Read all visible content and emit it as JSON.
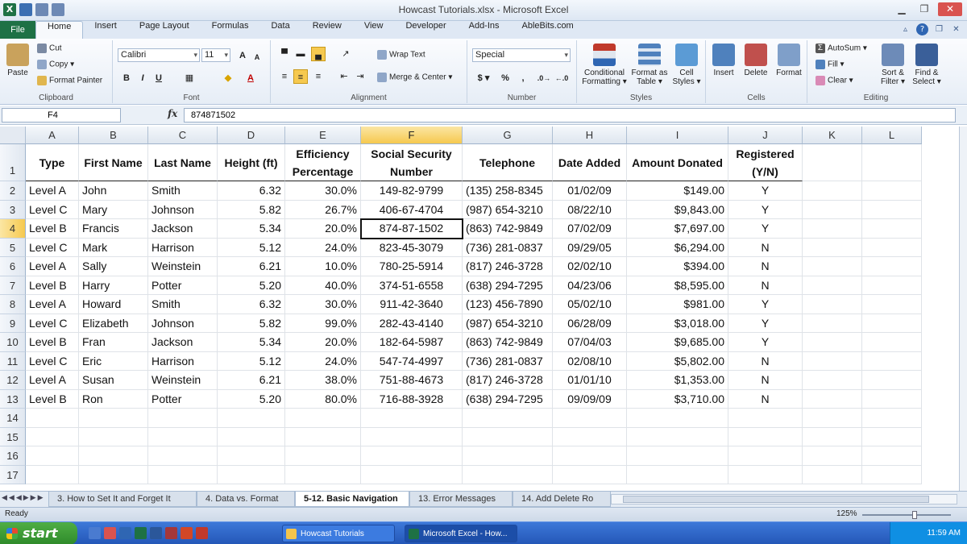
{
  "window": {
    "title": "Howcast Tutorials.xlsx - Microsoft Excel"
  },
  "tabs": [
    "File",
    "Home",
    "Insert",
    "Page Layout",
    "Formulas",
    "Data",
    "Review",
    "View",
    "Developer",
    "Add-Ins",
    "AbleBits.com"
  ],
  "ribbon": {
    "clipboard": {
      "paste": "Paste",
      "cut": "Cut",
      "copy": "Copy ▾",
      "format_painter": "Format Painter",
      "label": "Clipboard"
    },
    "font": {
      "name": "Calibri",
      "size": "11",
      "label": "Font"
    },
    "alignment": {
      "wrap": "Wrap Text",
      "merge": "Merge & Center ▾",
      "label": "Alignment"
    },
    "number": {
      "format": "Special",
      "label": "Number",
      "currency": "$ ▾",
      "percent": "%",
      "comma": ","
    },
    "styles": {
      "conditional": "Conditional Formatting ▾",
      "format_table": "Format as Table ▾",
      "cell_styles": "Cell Styles ▾",
      "label": "Styles"
    },
    "cells": {
      "insert": "Insert",
      "delete": "Delete",
      "format": "Format",
      "label": "Cells"
    },
    "editing": {
      "autosum": "AutoSum ▾",
      "fill": "Fill ▾",
      "clear": "Clear ▾",
      "sort": "Sort & Filter ▾",
      "find": "Find & Select ▾",
      "label": "Editing"
    }
  },
  "formula_bar": {
    "name_box": "F4",
    "fx": "fx",
    "value": "874871502"
  },
  "grid": {
    "columns": [
      "A",
      "B",
      "C",
      "D",
      "E",
      "F",
      "G",
      "H",
      "I",
      "J",
      "K",
      "L"
    ],
    "rows": [
      "1",
      "2",
      "3",
      "4",
      "5",
      "6",
      "7",
      "8",
      "9",
      "10",
      "11",
      "12",
      "13",
      "14",
      "15",
      "16",
      "17"
    ],
    "headers": [
      "Type",
      "First Name",
      "Last Name",
      "Height (ft)",
      "Efficiency Percentage",
      "Social Security Number",
      "Telephone",
      "Date Added",
      "Amount Donated",
      "Registered (Y/N)"
    ],
    "data": [
      [
        "Level A",
        "John",
        "Smith",
        "6.32",
        "30.0%",
        "149-82-9799",
        "(135) 258-8345",
        "01/02/09",
        "$149.00",
        "Y"
      ],
      [
        "Level C",
        "Mary",
        "Johnson",
        "5.82",
        "26.7%",
        "406-67-4704",
        "(987) 654-3210",
        "08/22/10",
        "$9,843.00",
        "Y"
      ],
      [
        "Level B",
        "Francis",
        "Jackson",
        "5.34",
        "20.0%",
        "874-87-1502",
        "(863) 742-9849",
        "07/02/09",
        "$7,697.00",
        "Y"
      ],
      [
        "Level C",
        "Mark",
        "Harrison",
        "5.12",
        "24.0%",
        "823-45-3079",
        "(736) 281-0837",
        "09/29/05",
        "$6,294.00",
        "N"
      ],
      [
        "Level A",
        "Sally",
        "Weinstein",
        "6.21",
        "10.0%",
        "780-25-5914",
        "(817) 246-3728",
        "02/02/10",
        "$394.00",
        "N"
      ],
      [
        "Level B",
        "Harry",
        "Potter",
        "5.20",
        "40.0%",
        "374-51-6558",
        "(638) 294-7295",
        "04/23/06",
        "$8,595.00",
        "N"
      ],
      [
        "Level A",
        "Howard",
        "Smith",
        "6.32",
        "30.0%",
        "911-42-3640",
        "(123) 456-7890",
        "05/02/10",
        "$981.00",
        "Y"
      ],
      [
        "Level C",
        "Elizabeth",
        "Johnson",
        "5.82",
        "99.0%",
        "282-43-4140",
        "(987) 654-3210",
        "06/28/09",
        "$3,018.00",
        "Y"
      ],
      [
        "Level B",
        "Fran",
        "Jackson",
        "5.34",
        "20.0%",
        "182-64-5987",
        "(863) 742-9849",
        "07/04/03",
        "$9,685.00",
        "Y"
      ],
      [
        "Level C",
        "Eric",
        "Harrison",
        "5.12",
        "24.0%",
        "547-74-4997",
        "(736) 281-0837",
        "02/08/10",
        "$5,802.00",
        "N"
      ],
      [
        "Level A",
        "Susan",
        "Weinstein",
        "6.21",
        "38.0%",
        "751-88-4673",
        "(817) 246-3728",
        "01/01/10",
        "$1,353.00",
        "N"
      ],
      [
        "Level B",
        "Ron",
        "Potter",
        "5.20",
        "80.0%",
        "716-88-3928",
        "(638) 294-7295",
        "09/09/09",
        "$3,710.00",
        "N"
      ]
    ],
    "active_cell": {
      "column": "F",
      "row": "4"
    }
  },
  "sheets": [
    "3. How to Set It and Forget It",
    "4. Data vs. Format",
    "5-12. Basic Navigation",
    "13. Error Messages",
    "14. Add Delete Ro"
  ],
  "active_sheet": "5-12. Basic Navigation",
  "status": {
    "ready": "Ready",
    "zoom": "125%"
  },
  "taskbar": {
    "start": "start",
    "items": [
      "Howcast Tutorials",
      "Microsoft Excel - How..."
    ],
    "clock": "11:59 AM"
  },
  "colors": {
    "excel_green": "#1e7145",
    "selection": "#f6c94f",
    "taskbar_blue": "#2457b8"
  }
}
